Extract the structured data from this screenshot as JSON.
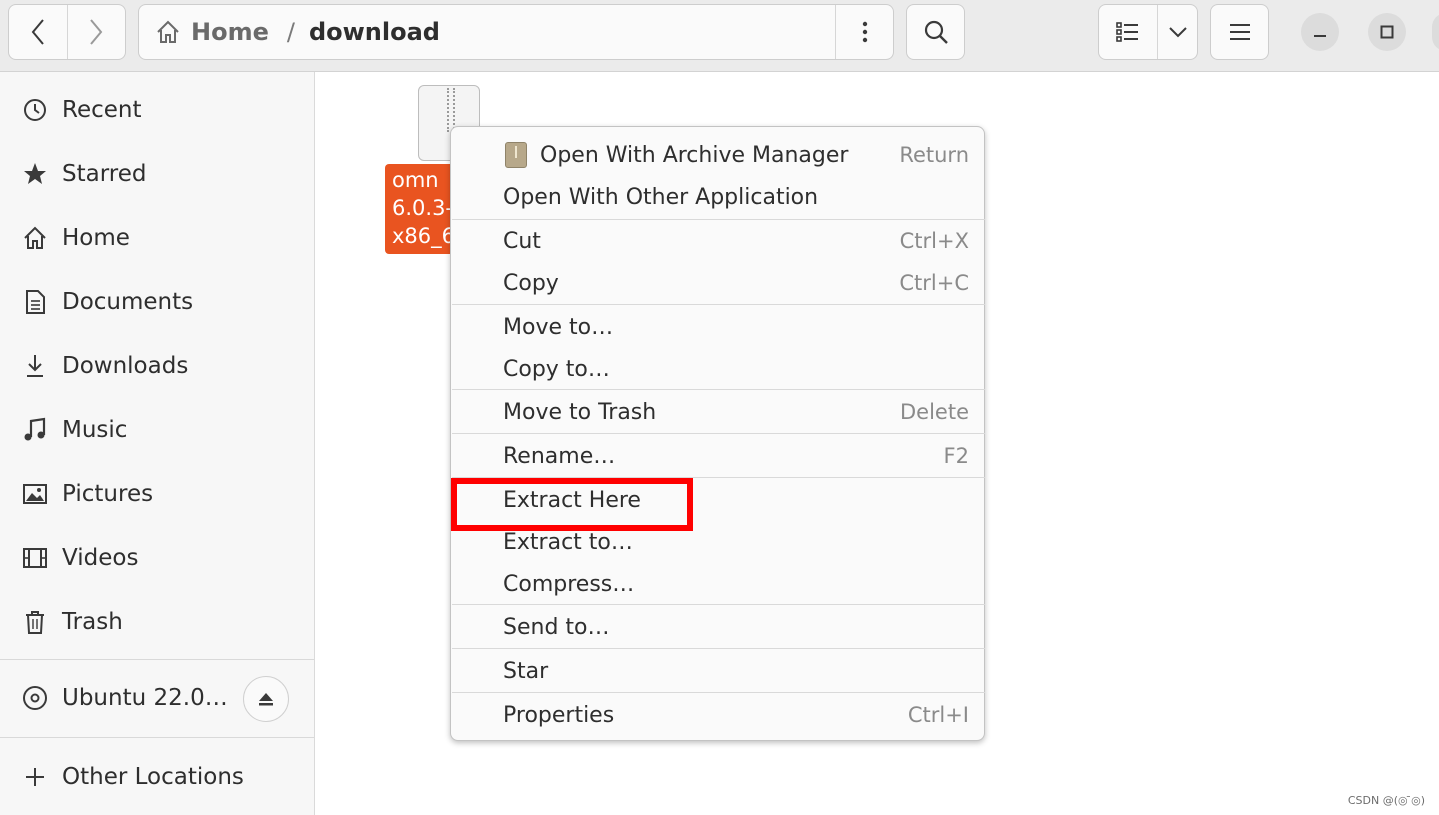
{
  "header": {
    "back_icon": "chevron-left-icon",
    "forward_icon": "chevron-right-icon",
    "path": {
      "home_label": "Home",
      "separator": "/",
      "current": "download"
    },
    "path_menu_icon": "vertical-dots-icon",
    "search_icon": "search-icon",
    "view_icon": "list-view-icon",
    "view_dropdown_icon": "chevron-down-icon",
    "main_menu_icon": "hamburger-icon",
    "minimize_icon": "minimize-icon",
    "maximize_icon": "maximize-icon"
  },
  "sidebar": {
    "items": [
      {
        "label": "Recent",
        "icon": "clock-icon"
      },
      {
        "label": "Starred",
        "icon": "star-icon"
      },
      {
        "label": "Home",
        "icon": "home-icon"
      },
      {
        "label": "Documents",
        "icon": "document-icon"
      },
      {
        "label": "Downloads",
        "icon": "download-icon"
      },
      {
        "label": "Music",
        "icon": "music-note-icon"
      },
      {
        "label": "Pictures",
        "icon": "picture-icon"
      },
      {
        "label": "Videos",
        "icon": "film-icon"
      },
      {
        "label": "Trash",
        "icon": "trash-icon"
      }
    ],
    "drive": {
      "label": "Ubuntu 22.0…",
      "icon": "disc-icon",
      "eject_icon": "eject-icon"
    },
    "other_locations": {
      "label": "Other Locations",
      "icon": "plus-icon"
    }
  },
  "file": {
    "name_visible": "omn\n6.0.3-\nx86_6",
    "icon": "archive-file-icon"
  },
  "context_menu": {
    "items": [
      {
        "label": "Open With Archive Manager",
        "shortcut": "Return",
        "icon": "archive-manager-icon"
      },
      {
        "label": "Open With Other Application",
        "shortcut": ""
      },
      {
        "label": "Cut",
        "shortcut": "Ctrl+X"
      },
      {
        "label": "Copy",
        "shortcut": "Ctrl+C"
      },
      {
        "label": "Move to…",
        "shortcut": ""
      },
      {
        "label": "Copy to…",
        "shortcut": ""
      },
      {
        "label": "Move to Trash",
        "shortcut": "Delete"
      },
      {
        "label": "Rename…",
        "shortcut": "F2"
      },
      {
        "label": "Extract Here",
        "shortcut": ""
      },
      {
        "label": "Extract to…",
        "shortcut": ""
      },
      {
        "label": "Compress…",
        "shortcut": ""
      },
      {
        "label": "Send to…",
        "shortcut": ""
      },
      {
        "label": "Star",
        "shortcut": ""
      },
      {
        "label": "Properties",
        "shortcut": "Ctrl+I"
      }
    ]
  },
  "annotation": {
    "highlighted_item": "Extract Here",
    "color": "#ff0000"
  },
  "watermark": "CSDN @(◎ ̄◎)"
}
